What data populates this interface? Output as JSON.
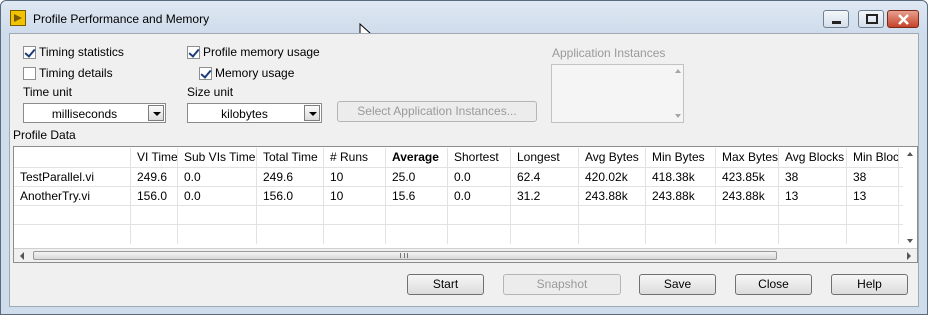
{
  "window": {
    "title": "Profile Performance and Memory"
  },
  "options": {
    "timing_statistics": {
      "label": "Timing statistics",
      "checked": true
    },
    "timing_details": {
      "label": "Timing details",
      "checked": false
    },
    "profile_memory_usage": {
      "label": "Profile memory usage",
      "checked": true
    },
    "memory_usage": {
      "label": "Memory usage",
      "checked": true
    },
    "time_unit": {
      "label": "Time unit",
      "value": "milliseconds"
    },
    "size_unit": {
      "label": "Size unit",
      "value": "kilobytes"
    },
    "select_instances_button": "Select Application Instances...",
    "application_instances_label": "Application Instances"
  },
  "profile_data": {
    "label": "Profile Data",
    "columns": [
      "",
      "VI Time",
      "Sub VIs Time",
      "Total Time",
      "# Runs",
      "Average",
      "Shortest",
      "Longest",
      "Avg Bytes",
      "Min Bytes",
      "Max Bytes",
      "Avg Blocks",
      "Min Bloc"
    ],
    "rows": [
      [
        "TestParallel.vi",
        "249.6",
        "0.0",
        "249.6",
        "10",
        "25.0",
        "0.0",
        "62.4",
        "420.02k",
        "418.38k",
        "423.85k",
        "38",
        "38"
      ],
      [
        "AnotherTry.vi",
        "156.0",
        "0.0",
        "156.0",
        "10",
        "15.6",
        "0.0",
        "31.2",
        "243.88k",
        "243.88k",
        "243.88k",
        "13",
        "13"
      ]
    ],
    "sorted_column": "Average"
  },
  "buttons": {
    "start": "Start",
    "snapshot": "Snapshot",
    "save": "Save",
    "close": "Close",
    "help": "Help"
  }
}
